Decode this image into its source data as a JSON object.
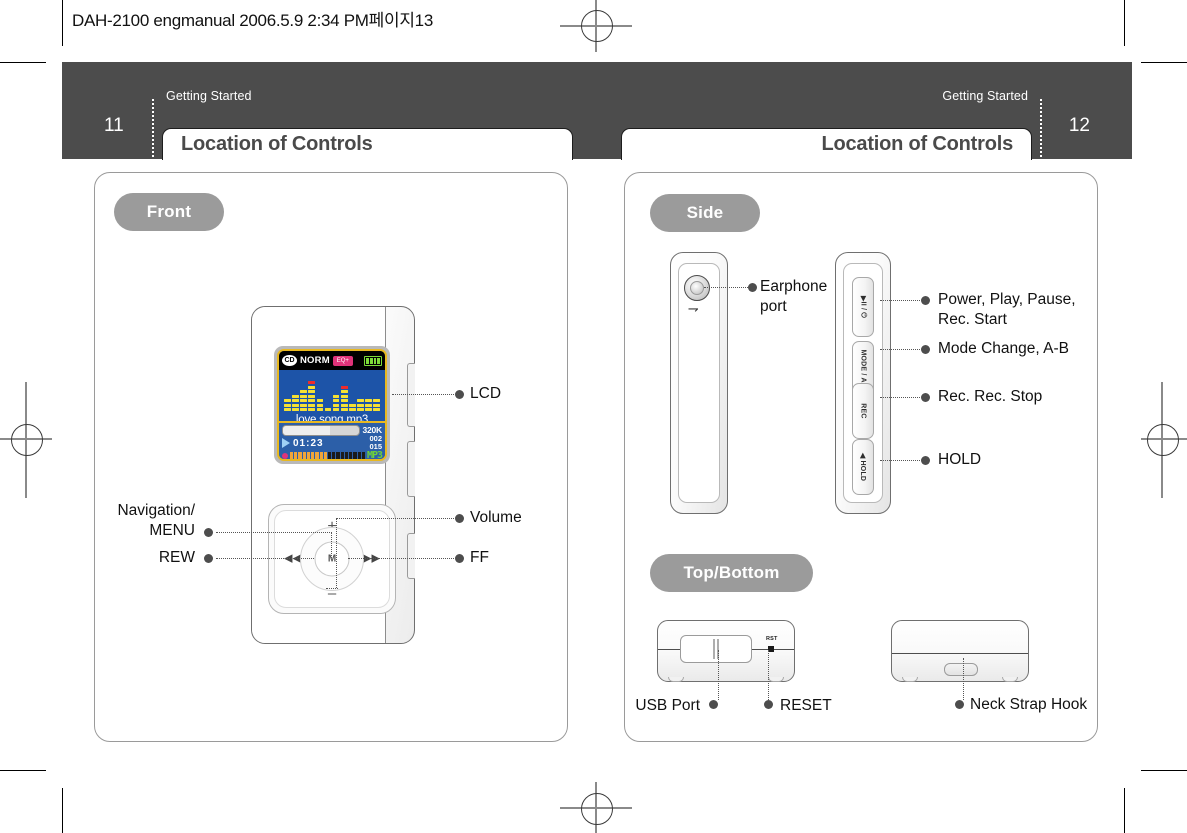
{
  "slug": "DAH-2100 engmanual  2006.5.9 2:34 PM페이지13",
  "colors": {
    "header_band": "#4c4c4c",
    "badge": "#9b9b9b",
    "title_text": "#4a4a4a",
    "lcd_screen": "#1d54a8",
    "lcd_bezel": "#e8b820",
    "eq_bar": "#f5e033",
    "eq_peak": "#ef2b2b",
    "mp3_logo": "#6fd13a",
    "battery": "#7ddc3a",
    "accent_pink": "#e0337a"
  },
  "pages": {
    "left": {
      "number": "11",
      "kicker": "Getting Started",
      "title": "Location of Controls",
      "badge": "Front",
      "callouts": {
        "lcd": "LCD",
        "navigation_menu": "Navigation/\nMENU",
        "rew": "REW",
        "volume": "Volume",
        "ff": "FF"
      },
      "device": {
        "pad": {
          "plus": "+",
          "minus": "–",
          "center": "M",
          "rew_icon": "◀◀",
          "ff_icon": "▶▶"
        },
        "lcd": {
          "mode_icon": "mode-repeat-icon",
          "mode_label": "NORM",
          "eq_icon": "equalizer-icon",
          "battery_icon": "battery-icon",
          "battery_bars": 4,
          "track_name": "love song.mp3",
          "bitrate": "320K",
          "time": "01:23",
          "track_current": "002",
          "track_total": "015",
          "format_logo": "MP3",
          "progress_percent": 62,
          "volume_level": 9,
          "volume_steps": 18,
          "eq_columns": [
            {
              "bars": 3,
              "peak": false
            },
            {
              "bars": 4,
              "peak": false
            },
            {
              "bars": 5,
              "peak": false
            },
            {
              "bars": 6,
              "peak": true
            },
            {
              "bars": 3,
              "peak": false
            },
            {
              "bars": 1,
              "peak": false
            },
            {
              "bars": 4,
              "peak": false
            },
            {
              "bars": 5,
              "peak": true
            },
            {
              "bars": 2,
              "peak": false
            },
            {
              "bars": 3,
              "peak": false
            },
            {
              "bars": 3,
              "peak": false
            },
            {
              "bars": 3,
              "peak": false
            }
          ]
        }
      }
    },
    "right": {
      "number": "12",
      "kicker": "Getting Started",
      "title": "Location of Controls",
      "badge_side": "Side",
      "badge_topbottom": "Top/Bottom",
      "callouts": {
        "earphone_port": "Earphone\nport",
        "power_play_pause": "Power, Play, Pause,\nRec. Start",
        "mode_change": "Mode Change, A-B",
        "rec_stop": "Rec. Rec. Stop",
        "hold": "HOLD",
        "usb_port": "USB Port",
        "reset": "RESET",
        "neck_strap_hook": "Neck Strap Hook"
      },
      "side_buttons": [
        "▶II / ⏻",
        "MODE / A-B",
        "REC",
        "◀ HOLD"
      ],
      "device_marks": {
        "reset_label": "RST"
      }
    }
  }
}
